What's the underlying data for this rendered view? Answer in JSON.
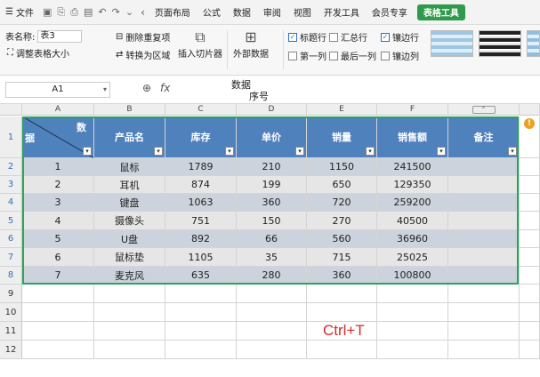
{
  "ribbon_tabs": {
    "file": "文件",
    "tabs": [
      "页面布局",
      "公式",
      "数据",
      "审阅",
      "视图",
      "开发工具",
      "会员专享"
    ],
    "active": "表格工具"
  },
  "ribbon": {
    "table_name_label": "表名称:",
    "table_name_value": "表3",
    "resize": "调整表格大小",
    "remove_dup": "删除重复项",
    "to_range": "转换为区域",
    "slicer": "插入切片器",
    "external": "外部数据",
    "header_row": "标题行",
    "total_row": "汇总行",
    "banded_rows": "镶边行",
    "first_col": "第一列",
    "last_col": "最后一列",
    "banded_cols": "镶边列"
  },
  "formula_bar": {
    "cell_ref": "A1",
    "fx": "fx",
    "content_line1": "数据",
    "content_line2": "序号"
  },
  "columns": [
    "A",
    "B",
    "C",
    "D",
    "E",
    "F",
    "G"
  ],
  "rows": [
    "1",
    "2",
    "3",
    "4",
    "5",
    "6",
    "7",
    "8",
    "9",
    "10",
    "11",
    "12"
  ],
  "table": {
    "corner_top": "数",
    "corner_left": "据",
    "headers": [
      "产品名",
      "库存",
      "单价",
      "销量",
      "销售额",
      "备注"
    ],
    "data": [
      [
        "1",
        "鼠标",
        "1789",
        "210",
        "1150",
        "241500",
        ""
      ],
      [
        "2",
        "耳机",
        "874",
        "199",
        "650",
        "129350",
        ""
      ],
      [
        "3",
        "键盘",
        "1063",
        "360",
        "720",
        "259200",
        ""
      ],
      [
        "4",
        "摄像头",
        "751",
        "150",
        "270",
        "40500",
        ""
      ],
      [
        "5",
        "U盘",
        "892",
        "66",
        "560",
        "36960",
        ""
      ],
      [
        "6",
        "鼠标垫",
        "1105",
        "35",
        "715",
        "25025",
        ""
      ],
      [
        "7",
        "麦克风",
        "635",
        "280",
        "360",
        "100800",
        ""
      ]
    ]
  },
  "annotation": "Ctrl+T",
  "colors": {
    "header": "#4f81bd",
    "band_odd": "#ccd3dc",
    "band_even": "#e6e6e6",
    "accent": "#2f9a4c",
    "annotation": "#d42a2a"
  }
}
